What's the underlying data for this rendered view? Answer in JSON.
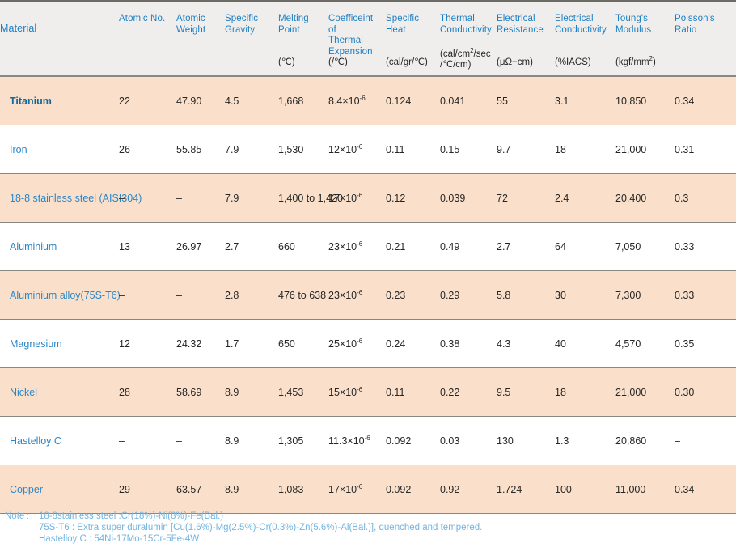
{
  "table": {
    "columns": [
      {
        "id": "material",
        "name": "Material",
        "unit": "",
        "unit2": ""
      },
      {
        "id": "atomic_no",
        "name": "Atomic No.",
        "unit": "",
        "unit2": ""
      },
      {
        "id": "atomic_wt",
        "name": "Atomic\nWeight",
        "unit": "",
        "unit2": ""
      },
      {
        "id": "sp_grav",
        "name": "Specific\nGravity",
        "unit": "",
        "unit2": ""
      },
      {
        "id": "melt_pt",
        "name": "Melting\nPoint",
        "unit": "(℃)",
        "unit2": ""
      },
      {
        "id": "cte",
        "name": "Coefficeint of\nThermal\nExpansion",
        "unit": "(/℃)",
        "unit2": ""
      },
      {
        "id": "sp_heat",
        "name": "Specific\nHeat",
        "unit": "(cal/gr/℃)",
        "unit2": ""
      },
      {
        "id": "th_cond",
        "name": "Thermal\nConductivity",
        "unit": "(cal/cm2/sec",
        "unit2": "/℃/cm)"
      },
      {
        "id": "el_res",
        "name": "Electrical\nResistance",
        "unit": "(μΩ−cm)",
        "unit2": ""
      },
      {
        "id": "el_cond",
        "name": "Electrical\nConductivity",
        "unit": "(%IACS)",
        "unit2": ""
      },
      {
        "id": "youngs",
        "name": "Toung's\nModulus",
        "unit": "(kgf/mm2)",
        "unit2": ""
      },
      {
        "id": "poisson",
        "name": "Poisson's\nRatio",
        "unit": "",
        "unit2": ""
      }
    ],
    "column_headers_flat": [
      "Material",
      "Atomic No.",
      "Atomic Weight",
      "Specific Gravity",
      "Melting Point",
      "Coefficeint of Thermal Expansion",
      "Specific Heat",
      "Thermal Conductivity",
      "Electrical Resistance",
      "Electrical Conductivity",
      "Toung's Modulus",
      "Poisson's Ratio"
    ],
    "rows": [
      {
        "material": "Titanium",
        "highlight": true,
        "shaded": true,
        "atomic_no": "22",
        "atomic_wt": "47.90",
        "sp_grav": "4.5",
        "melt_pt": "1,668",
        "cte_mant": "8.4×10",
        "cte_exp": "-6",
        "sp_heat": "0.124",
        "th_cond": "0.041",
        "el_res": "55",
        "el_cond": "3.1",
        "youngs": "10,850",
        "poisson": "0.34"
      },
      {
        "material": "Iron",
        "highlight": false,
        "shaded": false,
        "atomic_no": "26",
        "atomic_wt": "55.85",
        "sp_grav": "7.9",
        "melt_pt": "1,530",
        "cte_mant": "12×10",
        "cte_exp": "-6",
        "sp_heat": "0.11",
        "th_cond": "0.15",
        "el_res": "9.7",
        "el_cond": "18",
        "youngs": "21,000",
        "poisson": "0.31"
      },
      {
        "material": "18-8 stainless steel (AISI304)",
        "highlight": false,
        "shaded": true,
        "atomic_no": "–",
        "atomic_wt": "–",
        "sp_grav": "7.9",
        "melt_pt": "1,400 to 1,420",
        "cte_mant": "17×10",
        "cte_exp": "-6",
        "sp_heat": "0.12",
        "th_cond": "0.039",
        "el_res": "72",
        "el_cond": "2.4",
        "youngs": "20,400",
        "poisson": "0.3"
      },
      {
        "material": "Aluminium",
        "highlight": false,
        "shaded": false,
        "atomic_no": "13",
        "atomic_wt": "26.97",
        "sp_grav": "2.7",
        "melt_pt": "660",
        "cte_mant": "23×10",
        "cte_exp": "-6",
        "sp_heat": "0.21",
        "th_cond": "0.49",
        "el_res": "2.7",
        "el_cond": "64",
        "youngs": "7,050",
        "poisson": "0.33"
      },
      {
        "material": "Aluminium alloy(75S-T6)",
        "highlight": false,
        "shaded": true,
        "atomic_no": "–",
        "atomic_wt": "–",
        "sp_grav": "2.8",
        "melt_pt": "476 to 638",
        "cte_mant": "23×10",
        "cte_exp": "-6",
        "sp_heat": "0.23",
        "th_cond": "0.29",
        "el_res": "5.8",
        "el_cond": "30",
        "youngs": "7,300",
        "poisson": "0.33"
      },
      {
        "material": "Magnesium",
        "highlight": false,
        "shaded": false,
        "atomic_no": "12",
        "atomic_wt": "24.32",
        "sp_grav": "1.7",
        "melt_pt": "650",
        "cte_mant": "25×10",
        "cte_exp": "-6",
        "sp_heat": "0.24",
        "th_cond": "0.38",
        "el_res": "4.3",
        "el_cond": "40",
        "youngs": "4,570",
        "poisson": "0.35"
      },
      {
        "material": "Nickel",
        "highlight": false,
        "shaded": true,
        "atomic_no": "28",
        "atomic_wt": "58.69",
        "sp_grav": "8.9",
        "melt_pt": "1,453",
        "cte_mant": "15×10",
        "cte_exp": "-6",
        "sp_heat": "0.11",
        "th_cond": "0.22",
        "el_res": "9.5",
        "el_cond": "18",
        "youngs": "21,000",
        "poisson": "0.30"
      },
      {
        "material": "Hastelloy C",
        "highlight": false,
        "shaded": false,
        "atomic_no": "–",
        "atomic_wt": "–",
        "sp_grav": "8.9",
        "melt_pt": "1,305",
        "cte_mant": "11.3×10",
        "cte_exp": "-6",
        "sp_heat": "0.092",
        "th_cond": "0.03",
        "el_res": "130",
        "el_cond": "1.3",
        "youngs": "20,860",
        "poisson": "–"
      },
      {
        "material": "Copper",
        "highlight": false,
        "shaded": true,
        "atomic_no": "29",
        "atomic_wt": "63.57",
        "sp_grav": "8.9",
        "melt_pt": "1,083",
        "cte_mant": "17×10",
        "cte_exp": "-6",
        "sp_heat": "0.092",
        "th_cond": "0.92",
        "el_res": "1.724",
        "el_cond": "100",
        "youngs": "11,000",
        "poisson": "0.34"
      }
    ]
  },
  "notes": {
    "label": "Note :",
    "lines": [
      "18-8stainless steel :Cr(18%)-Ni(8%)-Fe(Bal.)",
      "75S-T6 : Extra super duralumin [Cu(1.6%)-Mg(2.5%)-Cr(0.3%)-Zn(5.6%)-Al(Bal.)], quenched and tempered.",
      "Hastelloy C : 54Ni-17Mo-15Cr-5Fe-4W"
    ]
  },
  "colors": {
    "header_bg": "#f0eeec",
    "row_shade": "#fae0ca",
    "row_plain": "#ffffff",
    "rule": "#8a8782",
    "top_rule": "#6d6b66",
    "header_text": "#1b7fc4",
    "material_text": "#2b87c8",
    "material_highlight": "#14679e",
    "value_text": "#262626",
    "note_text": "#74b4de"
  }
}
